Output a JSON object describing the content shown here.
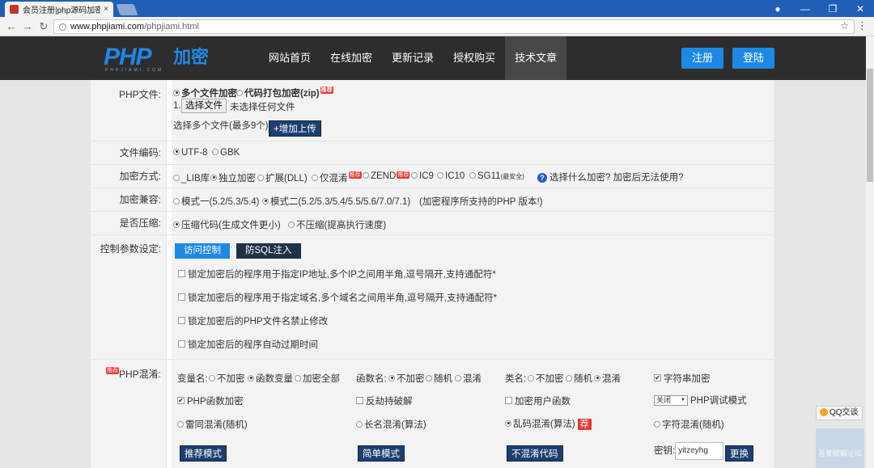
{
  "browser": {
    "tab_title": "会员注册|php源码加密|p",
    "tab_close": "×",
    "url_host": "www.phpjiami.com",
    "url_path": "/phpjiami.html",
    "star": "☆",
    "menu": "⋮",
    "nav_back": "←",
    "nav_forward": "→",
    "nav_reload": "↻",
    "win_user": "●",
    "win_min": "—",
    "win_max": "❐",
    "win_close": "✕"
  },
  "site": {
    "logo_php": "PHP",
    "logo_cn": "加密",
    "logo_sub": "PHPJIAMI.COM",
    "nav": [
      "网站首页",
      "在线加密",
      "更新记录",
      "授权购买",
      "技术文章"
    ],
    "active_nav": "技术文章",
    "register": "注册",
    "login": "登陆"
  },
  "form": {
    "php_file": {
      "label": "PHP文件:",
      "opt_multi": "多个文件加密",
      "opt_zip": "代码打包加密(zip)",
      "badge": "推荐",
      "index": "1.",
      "choose_btn": "选择文件",
      "no_file": "未选择任何文件",
      "multi_hint": "选择多个文件(最多9个):",
      "add_upload": "+增加上传"
    },
    "encoding": {
      "label": "文件编码:",
      "options": [
        "UTF-8",
        "GBK"
      ]
    },
    "method": {
      "label": "加密方式:",
      "options": [
        "_LIB库",
        "独立加密",
        "扩展(DLL)",
        "仅混淆",
        "ZEND",
        "IC9",
        "IC10",
        "SG11"
      ],
      "sg11_note": "(最安全)",
      "help_text": "选择什么加密?  加密后无法使用?"
    },
    "compat": {
      "label": "加密兼容:",
      "opt1": "模式一(5.2/5.3/5.4)",
      "opt2": "模式二(5.2/5.3/5.4/5.5/5.6/7.0/7.1)",
      "note": "(加密程序所支持的PHP 版本!)"
    },
    "compress": {
      "label": "是否压缩:",
      "opt1": "压缩代码(生成文件更小)",
      "opt2": "不压缩(提高执行速度)"
    },
    "control": {
      "label": "控制参数设定:",
      "tab_access": "访问控制",
      "tab_sql": "防SQL注入",
      "checks": [
        "锁定加密后的程序用于指定IP地址,多个IP之间用半角,逗号隔开,支持通配符*",
        "锁定加密后的程序用于指定域名,多个域名之间用半角,逗号隔开,支持通配符*",
        "锁定加密后的PHP文件名禁止修改",
        "锁定加密后的程序自动过期时间"
      ]
    },
    "obfuscate": {
      "label": "PHP混淆:",
      "var_label": "变量名:",
      "var_opts": [
        "不加密",
        "函数变量",
        "加密全部"
      ],
      "func_label": "函数名:",
      "func_opts": [
        "不加密",
        "随机",
        "混淆"
      ],
      "class_label": "类名:",
      "class_opts": [
        "不加密",
        "随机",
        "混淆"
      ],
      "string_enc": "字符串加密",
      "php_func_enc": "PHP函数加密",
      "anti_debug": "反劫持破解",
      "user_func_enc": "加密用户函数",
      "debug_select": "关闭",
      "debug_mode": "PHP调试模式",
      "mix1": "雷同混淆(随机)",
      "mix2": "长名混淆(算法)",
      "mix3": "乱码混淆(算法)",
      "mix3_tag": "荐",
      "mix4": "字符混淆(随机)",
      "btn_recommend": "推荐模式",
      "btn_simple": "简单模式",
      "btn_nomix": "不混淆代码",
      "key_label": "密钥:",
      "key_value": "yitzeyhg",
      "key_change": "更换"
    }
  },
  "side": {
    "qq": "QQ交谈",
    "watermark": "吾爱破解论坛"
  }
}
